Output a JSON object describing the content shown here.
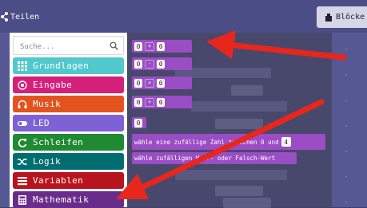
{
  "header": {
    "share_label": "Teilen",
    "blocks_tab_label": "Blöcke"
  },
  "toolbox": {
    "search_placeholder": "Suche...",
    "categories": [
      {
        "label": "Grundlagen",
        "color": "#1e90ff",
        "icon": "grid-icon"
      },
      {
        "label": "Eingabe",
        "color": "#d400d4",
        "icon": "target-icon"
      },
      {
        "label": "Musik",
        "color": "#e63022",
        "icon": "headphones-icon"
      },
      {
        "label": "LED",
        "color": "#5c2d91",
        "icon": "toggle-icon"
      },
      {
        "label": "Schleifen",
        "color": "#00aa00",
        "icon": "loop-icon"
      },
      {
        "label": "Logik",
        "color": "#00a4a6",
        "icon": "shuffle-icon"
      },
      {
        "label": "Variablen",
        "color": "#dc143c",
        "icon": "list-icon"
      },
      {
        "label": "Mathematik",
        "color": "#9400d3",
        "icon": "calculator-icon"
      }
    ]
  },
  "flyout": {
    "arith_blocks": [
      {
        "left": "0",
        "op": "+",
        "right": "0"
      },
      {
        "left": "0",
        "op": "-",
        "right": "0"
      },
      {
        "left": "0",
        "op": "×",
        "right": "0"
      },
      {
        "left": "0",
        "op": "÷",
        "right": "0"
      }
    ],
    "number_block": "0",
    "random_int_text": "wähle eine zufällige Zahl zwischen 0 und",
    "random_int_max": "4",
    "random_bool_text": "wähle zufälligen Wahr- oder Falsch-Wert"
  },
  "colors": {
    "topbar": "#4b4d86",
    "workspace": "#565893",
    "flyout": "#464668",
    "arrow": "#e8261c",
    "math_block": "#9a4dc4"
  }
}
